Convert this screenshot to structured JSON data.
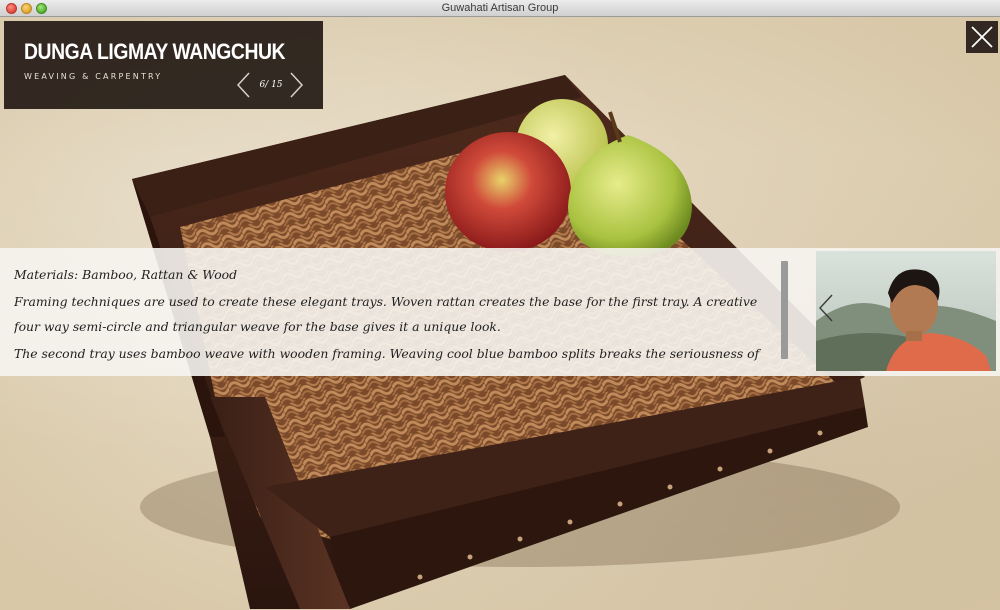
{
  "window": {
    "title": "Guwahati Artisan Group"
  },
  "header": {
    "artist_name": "DUNGA LIGMAY WANGCHUK",
    "craft": "WEAVING & CARPENTRY",
    "pager": "6/ 15"
  },
  "info": {
    "materials": "Materials: Bamboo, Rattan & Wood",
    "paragraph_1": "Framing techniques are used to create these elegant trays. Woven rattan creates the base for the first tray. A creative four way semi-circle and triangular weave for the base gives it a unique look.",
    "paragraph_2": "The second tray uses bamboo weave with wooden framing. Weaving cool blue bamboo splits breaks the seriousness of"
  },
  "icons": {
    "close": "close-icon",
    "prev": "chevron-left-icon",
    "next": "chevron-right-icon"
  }
}
